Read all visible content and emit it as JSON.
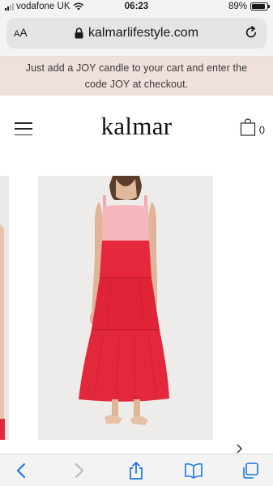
{
  "status_bar": {
    "carrier": "vodafone UK",
    "time": "06:23",
    "battery": "89%",
    "battery_level": 0.89
  },
  "browser": {
    "aa_label_big": "A",
    "aa_label_small": "A",
    "url": "kalmarlifestyle.com"
  },
  "announcement": {
    "line1": "Just add a JOY candle to your cart and enter the",
    "line2": "code JOY at checkout."
  },
  "header": {
    "logo": "kalmar",
    "cart_count": "0"
  },
  "colors": {
    "banner_bg": "#efe0dc",
    "dress_red": "#e5283b",
    "dress_pink": "#f6b7bc",
    "accent_blue": "#1a73e8"
  },
  "icons": [
    "signal-icon",
    "wifi-icon",
    "battery-icon",
    "lock-icon",
    "reload-icon",
    "hamburger-icon",
    "shopping-bag-icon",
    "chevron-right-icon",
    "back-icon",
    "forward-icon",
    "share-icon",
    "bookmarks-icon",
    "tabs-icon"
  ]
}
